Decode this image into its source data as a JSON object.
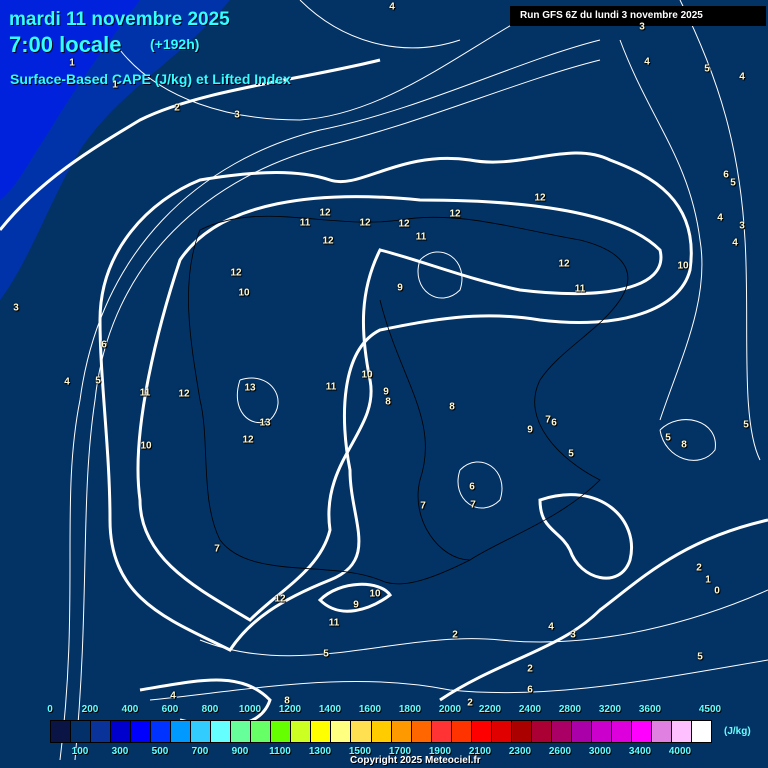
{
  "header": {
    "date": "mardi 11 novembre 2025",
    "time": "7:00 locale",
    "lead": "(+192h)",
    "parameter": "Surface-Based CAPE (J/kg) et Lifted Index",
    "run": "Run GFS 6Z du lundi 3 novembre 2025"
  },
  "contour_labels": [
    "4",
    "3",
    "4",
    "5",
    "4",
    "1",
    "2",
    "3",
    "6",
    "5",
    "4",
    "3",
    "4",
    "3",
    "1",
    "12",
    "11",
    "12",
    "12",
    "12",
    "11",
    "12",
    "12",
    "12",
    "10",
    "9",
    "10",
    "11",
    "12",
    "6",
    "4",
    "5",
    "12",
    "13",
    "13",
    "12",
    "10",
    "11",
    "10",
    "9",
    "8",
    "8",
    "9",
    "7",
    "6",
    "5",
    "7",
    "8",
    "5",
    "6",
    "7",
    "7",
    "12",
    "9",
    "10",
    "11",
    "11",
    "2",
    "1",
    "0",
    "2",
    "4",
    "3",
    "2",
    "5",
    "2",
    "6",
    "4",
    "8",
    "5",
    "5"
  ],
  "legend": {
    "unit": "(J/kg)",
    "colors": [
      "#0a1545",
      "#04306a",
      "#0a3399",
      "#0000cc",
      "#0000ff",
      "#0033ff",
      "#0099ff",
      "#33ccff",
      "#66ffff",
      "#66ff99",
      "#66ff66",
      "#66ff00",
      "#ccff22",
      "#ffff00",
      "#ffff80",
      "#ffe050",
      "#ffcc00",
      "#ff9900",
      "#ff6600",
      "#ff3333",
      "#ff3300",
      "#ff0000",
      "#e00000",
      "#aa0000",
      "#aa0033",
      "#aa0066",
      "#aa00aa",
      "#cc00cc",
      "#dd00dd",
      "#ff00ff",
      "#e080e0",
      "#ffc0ff",
      "#ffffff"
    ],
    "top_ticks": [
      "0",
      "200",
      "400",
      "600",
      "800",
      "1000",
      "1200",
      "1400",
      "1600",
      "1800",
      "2000",
      "2200",
      "2400",
      "2800",
      "3200",
      "3600",
      "4500"
    ],
    "bottom_ticks": [
      "100",
      "300",
      "500",
      "700",
      "900",
      "1100",
      "1300",
      "1500",
      "1700",
      "1900",
      "2100",
      "2300",
      "2600",
      "3000",
      "3400",
      "4000"
    ]
  },
  "copyright": "Copyright 2025 Meteociel.fr"
}
